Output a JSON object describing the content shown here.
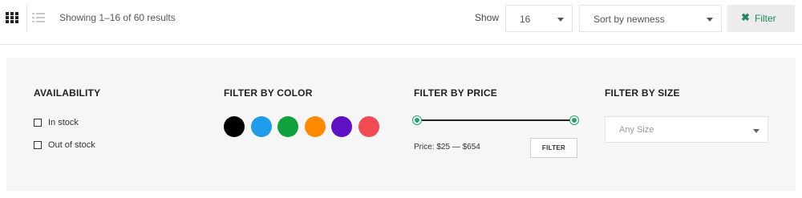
{
  "toolbar": {
    "results_text": "Showing 1–16 of 60 results",
    "show_label": "Show",
    "show_value": "16",
    "sort_value": "Sort by newness",
    "filter_icon": "✖",
    "filter_label": "Filter",
    "view_grid_icon": "grid-icon",
    "view_list_icon": "list-icon"
  },
  "filters": {
    "availability": {
      "title": "AVAILABILITY",
      "options": [
        {
          "label": "In stock",
          "checked": false
        },
        {
          "label": "Out of stock",
          "checked": false
        }
      ]
    },
    "color": {
      "title": "FILTER BY COLOR",
      "swatches": [
        "#000000",
        "#1e9bea",
        "#10a13c",
        "#ff8a00",
        "#6010c4",
        "#f14a52"
      ]
    },
    "price": {
      "title": "FILTER BY PRICE",
      "range_label": "Price: $25 — $654",
      "min": "$25",
      "max": "$654",
      "button_label": "FILTER",
      "handle_color": "#1fa56b"
    },
    "size": {
      "title": "FILTER BY SIZE",
      "placeholder": "Any Size"
    }
  },
  "colors": {
    "accent": "#1f8a5b",
    "panel_bg": "#f6f6f6"
  }
}
